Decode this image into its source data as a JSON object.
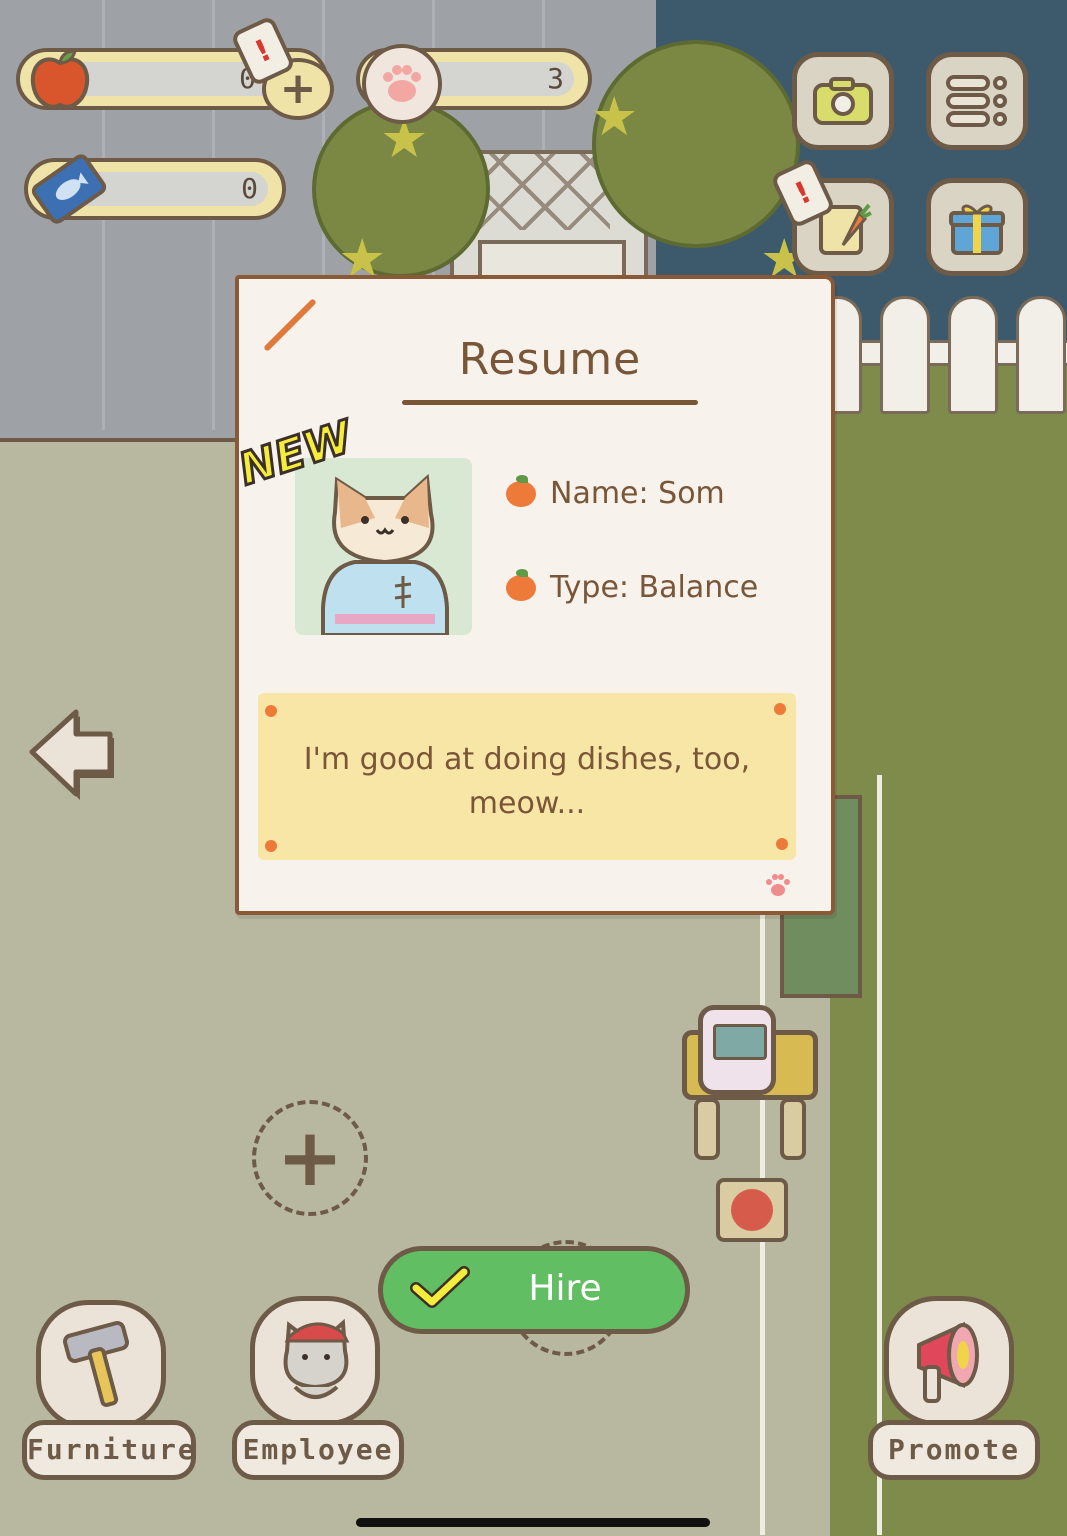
{
  "hud": {
    "apples_value": "0",
    "paws_value": "3",
    "tickets_value": "0"
  },
  "resume": {
    "title": "Resume",
    "new_badge": "NEW",
    "name_line": "Name: Som",
    "type_line": "Type: Balance",
    "quote": "I'm good at doing dishes, too, meow..."
  },
  "actions": {
    "hire_label": "Hire"
  },
  "bottom_menu": {
    "furniture": "Furniture",
    "employee": "Employee",
    "promote": "Promote"
  },
  "icons": {
    "apple": "apple-icon",
    "paw": "paw-icon",
    "ticket": "fish-ticket-icon",
    "camera": "camera-icon",
    "menu": "list-menu-icon",
    "tasks": "carrot-clipboard-icon",
    "gift": "gift-icon",
    "back": "back-arrow-icon",
    "add": "plus-icon",
    "check": "checkmark-icon"
  },
  "colors": {
    "hire_green": "#62be63",
    "card_border": "#8a5a36",
    "note_yellow": "#f8e6a6",
    "accent_orange": "#ee7a3a",
    "new_yellow": "#f5ec3c"
  }
}
